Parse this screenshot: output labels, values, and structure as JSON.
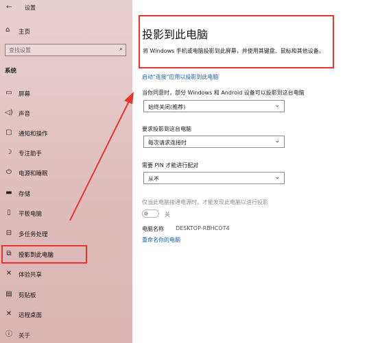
{
  "window": {
    "title": "设置"
  },
  "sidebar": {
    "home": "主页",
    "search_placeholder": "查找设置",
    "section": "系统",
    "items": [
      {
        "label": "屏幕",
        "icon": "monitor-icon"
      },
      {
        "label": "声音",
        "icon": "speaker-icon"
      },
      {
        "label": "通知和操作",
        "icon": "notification-icon"
      },
      {
        "label": "专注助手",
        "icon": "moon-icon"
      },
      {
        "label": "电源和睡眠",
        "icon": "power-icon"
      },
      {
        "label": "存储",
        "icon": "storage-icon"
      },
      {
        "label": "平板电脑",
        "icon": "tablet-icon"
      },
      {
        "label": "多任务处理",
        "icon": "multitask-icon"
      },
      {
        "label": "投影到此电脑",
        "icon": "project-icon",
        "active": true
      },
      {
        "label": "体验共享",
        "icon": "share-icon"
      },
      {
        "label": "剪贴板",
        "icon": "clipboard-icon"
      },
      {
        "label": "远程桌面",
        "icon": "remote-icon"
      },
      {
        "label": "关于",
        "icon": "info-icon"
      }
    ]
  },
  "main": {
    "title": "投影到此电脑",
    "description": "将 Windows 手机或电脑投影到此屏幕，并使用其键盘、鼠标和其他设备。",
    "connect_link": "启动\"连接\"应用以投影到此电脑",
    "q1_label": "当你同意时，部分 Windows 和 Android 设备可以投影到这台电脑",
    "q1_value": "始终关闭(推荐)",
    "q2_label": "要求投影到这台电脑",
    "q2_value": "每次请求连接时",
    "q3_label": "需要 PIN 才能进行配对",
    "q3_value": "从不",
    "power_label": "仅当此电脑接通电源时，才能发现此电脑以进行投影",
    "toggle_state": "关",
    "pc_name_label": "电脑名称",
    "pc_name_value": "DESKTOP-RBHCOT4",
    "rename_link": "重命名你的电脑"
  },
  "colors": {
    "highlight": "#e8332e",
    "link": "#1a5fb4"
  }
}
